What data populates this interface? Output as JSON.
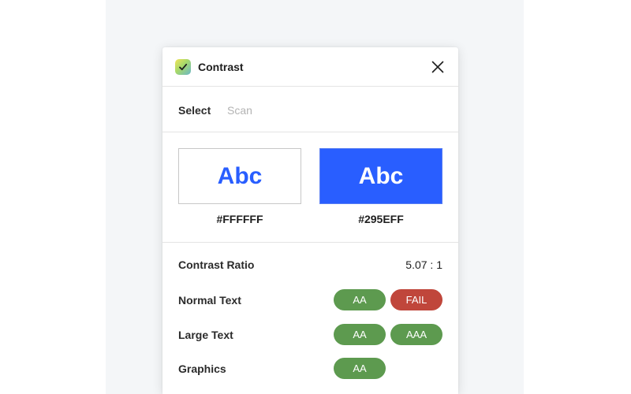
{
  "window": {
    "title": "Contrast",
    "app_icon": "check-icon",
    "close_icon": "close-icon"
  },
  "tabs": [
    {
      "label": "Select",
      "active": true
    },
    {
      "label": "Scan",
      "active": false
    }
  ],
  "colors": {
    "foreground": {
      "hex": "#FFFFFF",
      "sample_text": "Abc"
    },
    "background": {
      "hex": "#295EFF",
      "sample_text": "Abc"
    },
    "accent": "#295eff",
    "pass": "#5d9a4f",
    "fail": "#c0463b"
  },
  "results": {
    "ratio": {
      "label": "Contrast Ratio",
      "value": "5.07 : 1"
    },
    "normal_text": {
      "label": "Normal Text",
      "badges": [
        {
          "label": "AA",
          "status": "pass"
        },
        {
          "label": "FAIL",
          "status": "fail"
        }
      ]
    },
    "large_text": {
      "label": "Large Text",
      "badges": [
        {
          "label": "AA",
          "status": "pass"
        },
        {
          "label": "AAA",
          "status": "pass"
        }
      ]
    },
    "graphics": {
      "label": "Graphics",
      "badges": [
        {
          "label": "AA",
          "status": "pass"
        }
      ]
    }
  }
}
